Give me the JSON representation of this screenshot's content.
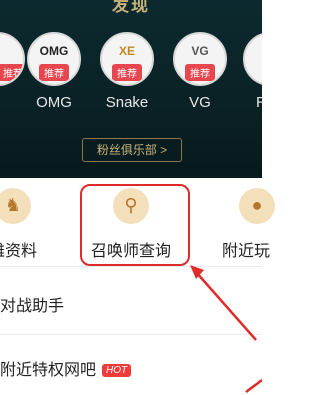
{
  "header": {
    "title": "发现",
    "teams": [
      {
        "name": "",
        "logo": "",
        "tag": "推荐"
      },
      {
        "name": "OMG",
        "logo": "OMG",
        "tag": "推荐"
      },
      {
        "name": "Snake",
        "logo": "XE",
        "tag": "推荐"
      },
      {
        "name": "VG",
        "logo": "VG",
        "tag": "推荐"
      },
      {
        "name": "R",
        "logo": "",
        "tag": ""
      }
    ],
    "fans_button": "粉丝俱乐部 >"
  },
  "features": [
    {
      "label": "雄资料",
      "icon": "helmet-icon"
    },
    {
      "label": "召唤师查询",
      "icon": "summoner-search-icon"
    },
    {
      "label": "附近玩",
      "icon": "nearby-icon"
    }
  ],
  "list": [
    {
      "label": "对战助手"
    },
    {
      "label": "附近特权网吧",
      "badge": "HOT"
    }
  ],
  "colors": {
    "accent_red": "#e02b2b",
    "gold": "#c9b27a"
  }
}
